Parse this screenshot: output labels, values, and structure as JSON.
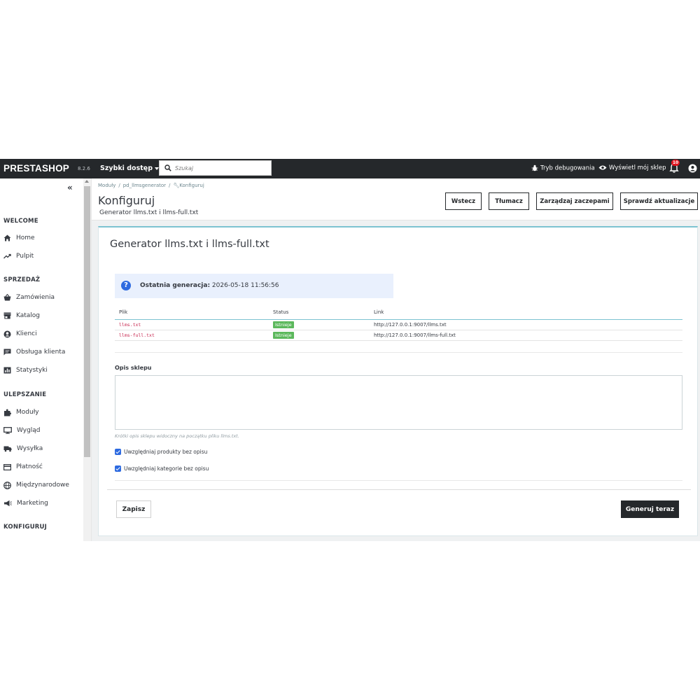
{
  "topbar": {
    "logo": "PRESTASHOP",
    "version": "8.2.6",
    "quick_access": "Szybki dostęp",
    "search_placeholder": "Szukaj",
    "debug_mode": "Tryb debugowania",
    "view_shop": "Wyświetl mój sklep",
    "notifications_count": "10"
  },
  "sidebar": {
    "collapse_glyph": "«",
    "sections": [
      {
        "title": "WELCOME",
        "items": [
          {
            "label": "Home",
            "icon": "home-icon"
          },
          {
            "label": "Pulpit",
            "icon": "trending-icon"
          }
        ]
      },
      {
        "title": "SPRZEDAŻ",
        "items": [
          {
            "label": "Zamówienia",
            "icon": "basket-icon"
          },
          {
            "label": "Katalog",
            "icon": "store-icon"
          },
          {
            "label": "Klienci",
            "icon": "account-icon"
          },
          {
            "label": "Obsługa klienta",
            "icon": "chat-icon"
          },
          {
            "label": "Statystyki",
            "icon": "bar-chart-icon"
          }
        ]
      },
      {
        "title": "ULEPSZANIE",
        "items": [
          {
            "label": "Moduły",
            "icon": "puzzle-icon"
          },
          {
            "label": "Wygląd",
            "icon": "desktop-icon"
          },
          {
            "label": "Wysyłka",
            "icon": "truck-icon"
          },
          {
            "label": "Płatność",
            "icon": "card-icon"
          },
          {
            "label": "Międzynarodowe",
            "icon": "globe-icon"
          },
          {
            "label": "Marketing",
            "icon": "megaphone-icon"
          }
        ]
      },
      {
        "title": "KONFIGURUJ",
        "items": []
      }
    ]
  },
  "header": {
    "breadcrumb": [
      "Moduły",
      "pd_llmsgenerator",
      "Konfiguruj"
    ],
    "title": "Konfiguruj",
    "subtitle": "Generator llms.txt i llms-full.txt",
    "buttons": {
      "back": "Wstecz",
      "translate": "Tłumacz",
      "hooks": "Zarządzaj zaczepami",
      "updates": "Sprawdź aktualizacje"
    }
  },
  "panel": {
    "title": "Generator llms.txt i llms-full.txt",
    "alert": {
      "label": "Ostatnia generacja:",
      "value": "2026-05-18 11:56:56"
    },
    "table": {
      "headers": [
        "Plik",
        "Status",
        "Link"
      ],
      "rows": [
        {
          "file": "llms.txt",
          "status": "Istnieje",
          "link": "http://127.0.0.1:9007/llms.txt"
        },
        {
          "file": "llms-full.txt",
          "status": "Istnieje",
          "link": "http://127.0.0.1:9007/llms-full.txt"
        }
      ]
    },
    "description_label": "Opis sklepu",
    "description_value": "",
    "description_help": "Krótki opis sklepu widoczny na początku pliku llms.txt.",
    "checkbox_products": "Uwzględniaj produkty bez opisu",
    "checkbox_categories": "Uwzględniaj kategorie bez opisu",
    "save_button": "Zapisz",
    "generate_button": "Generuj teraz"
  },
  "colors": {
    "topbar": "#25282b",
    "accent": "#7cc3d1",
    "success": "#5cb85c",
    "info_bg": "#e9f0fd",
    "primary": "#2d6ae0"
  }
}
